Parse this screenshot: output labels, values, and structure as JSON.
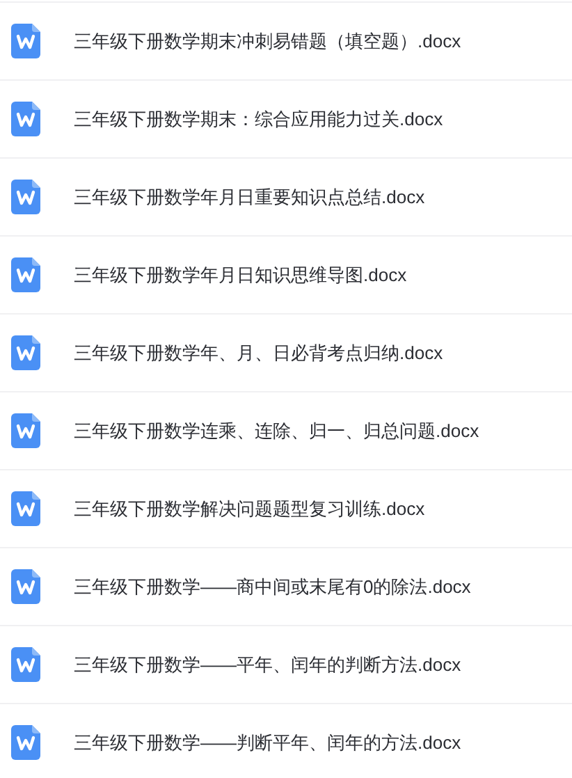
{
  "files": [
    {
      "name": "三年级下册数学期末冲刺易错题（填空题）.docx"
    },
    {
      "name": "三年级下册数学期末：综合应用能力过关.docx"
    },
    {
      "name": "三年级下册数学年月日重要知识点总结.docx"
    },
    {
      "name": "三年级下册数学年月日知识思维导图.docx"
    },
    {
      "name": "三年级下册数学年、月、日必背考点归纳.docx"
    },
    {
      "name": "三年级下册数学连乘、连除、归一、归总问题.docx"
    },
    {
      "name": "三年级下册数学解决问题题型复习训练.docx"
    },
    {
      "name": "三年级下册数学——商中间或末尾有0的除法.docx"
    },
    {
      "name": "三年级下册数学——平年、闰年的判断方法.docx"
    },
    {
      "name": "三年级下册数学——判断平年、闰年的方法.docx"
    }
  ]
}
